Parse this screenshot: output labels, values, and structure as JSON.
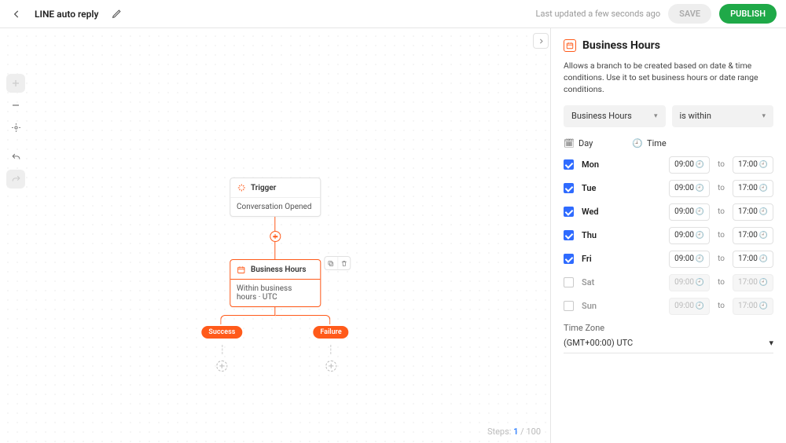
{
  "header": {
    "title": "LINE auto reply",
    "last_updated": "Last updated a few seconds ago",
    "save_label": "SAVE",
    "publish_label": "PUBLISH"
  },
  "canvas": {
    "trigger": {
      "title": "Trigger",
      "body": "Conversation Opened"
    },
    "node": {
      "title": "Business Hours",
      "body": "Within business hours · UTC"
    },
    "outcomes": {
      "success": "Success",
      "failure": "Failure"
    },
    "steps": {
      "label": "Steps:",
      "current": "1",
      "total": "100"
    }
  },
  "panel": {
    "title": "Business Hours",
    "description": "Allows a branch to be created based on date & time conditions. Use it to set business hours or date range conditions.",
    "type_dropdown": "Business Hours",
    "cond_dropdown": "is within",
    "day_header": "Day",
    "time_header": "Time",
    "to_label": "to",
    "days": [
      {
        "label": "Mon",
        "checked": true,
        "start": "09:00",
        "end": "17:00"
      },
      {
        "label": "Tue",
        "checked": true,
        "start": "09:00",
        "end": "17:00"
      },
      {
        "label": "Wed",
        "checked": true,
        "start": "09:00",
        "end": "17:00"
      },
      {
        "label": "Thu",
        "checked": true,
        "start": "09:00",
        "end": "17:00"
      },
      {
        "label": "Fri",
        "checked": true,
        "start": "09:00",
        "end": "17:00"
      },
      {
        "label": "Sat",
        "checked": false,
        "start": "09:00",
        "end": "17:00"
      },
      {
        "label": "Sun",
        "checked": false,
        "start": "09:00",
        "end": "17:00"
      }
    ],
    "timezone_label": "Time Zone",
    "timezone_value": "(GMT+00:00) UTC"
  }
}
